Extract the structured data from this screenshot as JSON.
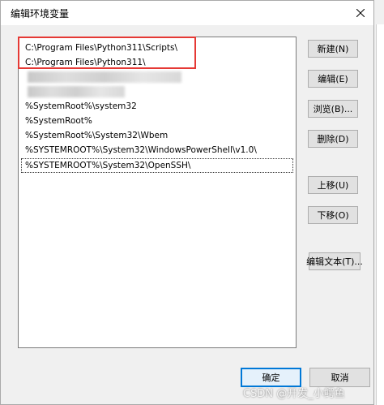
{
  "window": {
    "title": "编辑环境变量"
  },
  "list": {
    "items": [
      "C:\\Program Files\\Python311\\Scripts\\",
      "C:\\Program Files\\Python311\\",
      "",
      "",
      "%SystemRoot%\\system32",
      "%SystemRoot%",
      "%SystemRoot%\\System32\\Wbem",
      "%SYSTEMROOT%\\System32\\WindowsPowerShell\\v1.0\\",
      "%SYSTEMROOT%\\System32\\OpenSSH\\"
    ]
  },
  "buttons": {
    "new": "新建(N)",
    "edit": "编辑(E)",
    "browse": "浏览(B)...",
    "delete": "删除(D)",
    "move_up": "上移(U)",
    "move_down": "下移(O)",
    "edit_text": "编辑文本(T)...",
    "ok": "确定",
    "cancel": "取消"
  },
  "watermark": "CSDN @开发_小鳄鱼",
  "colors": {
    "highlight": "#e53935",
    "accent": "#0078d7"
  }
}
